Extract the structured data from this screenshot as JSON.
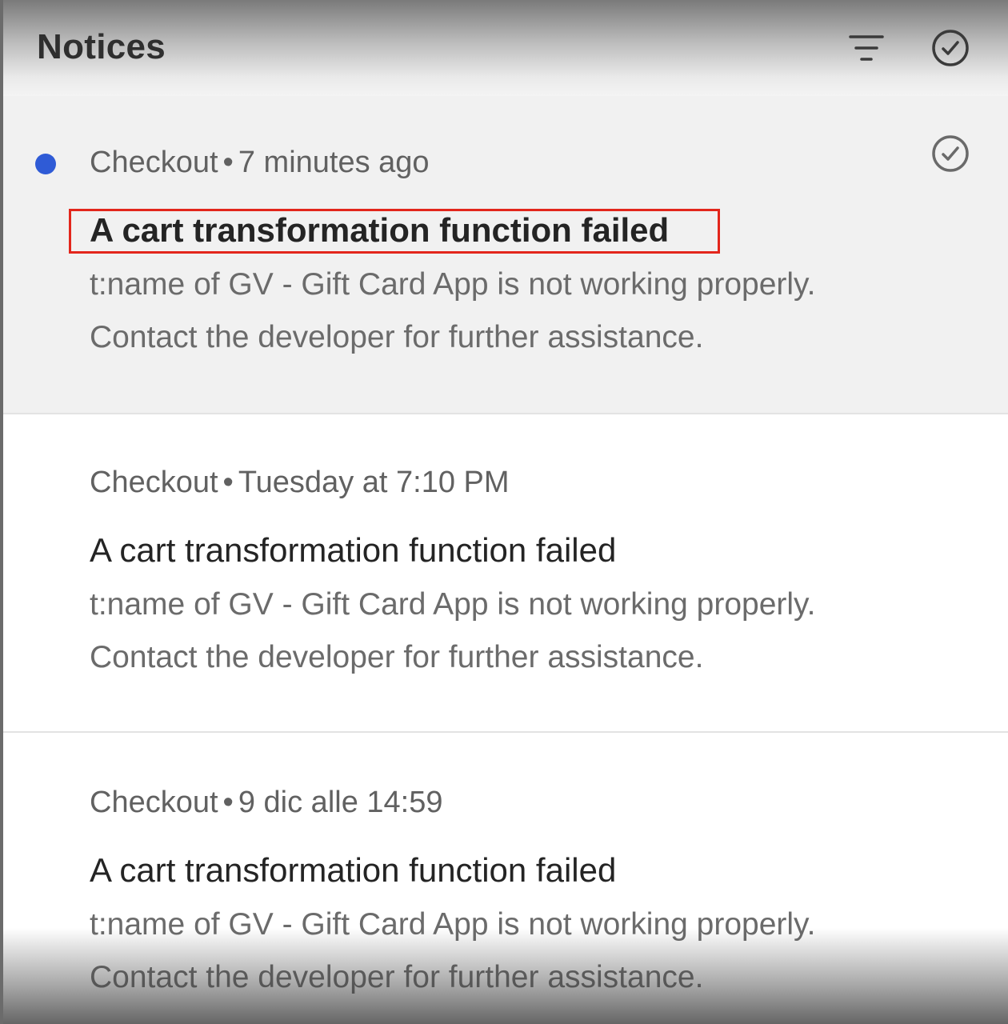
{
  "header": {
    "title": "Notices",
    "filter_icon": "filter-icon",
    "mark_all_icon": "check-circle-icon"
  },
  "notices": [
    {
      "source": "Checkout",
      "separator": "•",
      "time": "7 minutes ago",
      "title": "A cart transformation function failed",
      "line1": "t:name of GV - Gift Card App is not working properly.",
      "line2": "Contact the developer for further assistance.",
      "unread": true
    },
    {
      "source": "Checkout",
      "separator": "•",
      "time": "Tuesday at 7:10 PM",
      "title": "A cart transformation function failed",
      "line1": "t:name of GV - Gift Card App is not working properly.",
      "line2": "Contact the developer for further assistance.",
      "unread": false
    },
    {
      "source": "Checkout",
      "separator": "•",
      "time": "9 dic alle 14:59",
      "title": "A cart transformation function failed",
      "line1": "t:name of GV - Gift Card App is not working properly.",
      "line2": "Contact the developer for further assistance.",
      "unread": false
    }
  ],
  "colors": {
    "unread_dot": "#2f5bd6",
    "highlight": "#e3261c"
  }
}
